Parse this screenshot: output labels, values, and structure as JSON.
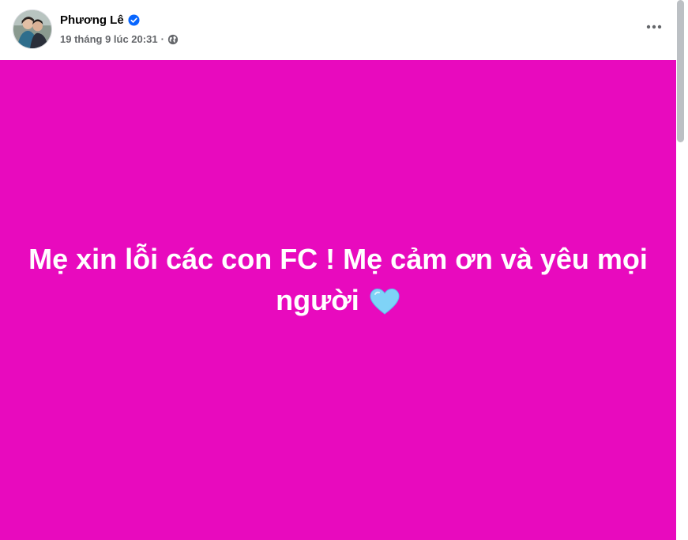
{
  "post": {
    "author_name": "Phương Lê",
    "timestamp": "19 tháng 9 lúc 20:31",
    "separator": "·",
    "text": "Mẹ xin lỗi các con FC ! Mẹ cảm ơn và yêu mọi người",
    "background_color": "#e80abe"
  },
  "icons": {
    "verified": "verified-badge-icon",
    "audience": "globe-icon",
    "more": "more-options-icon",
    "emoji": "light-blue-heart-icon"
  },
  "colors": {
    "verified_blue": "#0866ff",
    "meta_gray": "#65676b",
    "heart_blue": "#7fd3f7"
  }
}
